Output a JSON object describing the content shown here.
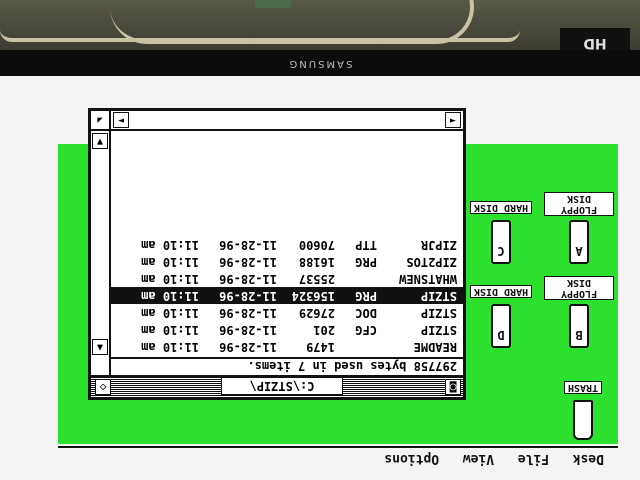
{
  "monitor": {
    "brand": "SAMSUNG",
    "badge": "HD"
  },
  "menubar": {
    "items": [
      "Desk",
      "File",
      "View",
      "Options"
    ]
  },
  "window": {
    "title": "C:\\STZIP\\",
    "info": "297758 bytes used in 7 items.",
    "files": [
      {
        "name": "README",
        "ext": "",
        "size": "1479",
        "date": "11-28-96",
        "time": "11:10 am",
        "selected": false
      },
      {
        "name": "STZIP",
        "ext": "CFG",
        "size": "201",
        "date": "11-28-96",
        "time": "11:10 am",
        "selected": false
      },
      {
        "name": "STZIP",
        "ext": "DOC",
        "size": "27629",
        "date": "11-28-96",
        "time": "11:10 am",
        "selected": false
      },
      {
        "name": "STZIP",
        "ext": "PRG",
        "size": "156324",
        "date": "11-28-96",
        "time": "11:10 am",
        "selected": true
      },
      {
        "name": "WHATSNEW",
        "ext": "",
        "size": "25537",
        "date": "11-28-96",
        "time": "11:10 am",
        "selected": false
      },
      {
        "name": "ZIP2TOS",
        "ext": "PRG",
        "size": "16188",
        "date": "11-28-96",
        "time": "11:10 am",
        "selected": false
      },
      {
        "name": "ZIPJR",
        "ext": "TTP",
        "size": "70600",
        "date": "11-28-96",
        "time": "11:10 am",
        "selected": false
      }
    ]
  },
  "icons": {
    "floppy_a": {
      "label": "FLOPPY DISK",
      "letter": "A"
    },
    "hard_c": {
      "label": "HARD DISK",
      "letter": "C"
    },
    "floppy_b": {
      "label": "FLOPPY DISK",
      "letter": "B"
    },
    "hard_d": {
      "label": "HARD DISK",
      "letter": "D"
    },
    "trash": {
      "label": "TRASH"
    }
  }
}
